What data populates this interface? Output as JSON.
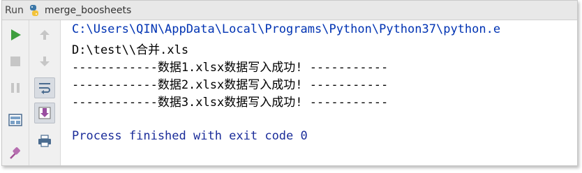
{
  "window": {
    "panel_label": "Run",
    "config_name": "merge_boosheets"
  },
  "console": {
    "lines": [
      "C:\\Users\\QIN\\AppData\\Local\\Programs\\Python\\Python37\\python.e",
      "D:\\test\\\\合并.xls",
      "------------数据1.xlsx数据写入成功! -----------",
      "------------数据2.xlsx数据写入成功! -----------",
      "------------数据3.xlsx数据写入成功! -----------",
      "",
      "Process finished with exit code 0"
    ]
  },
  "colors": {
    "command_text": "#0033b3",
    "finished_text": "#1b2d9a",
    "run_green": "#3e9e3e"
  },
  "icons": {
    "left_toolbar": [
      "run-icon",
      "stop-icon",
      "pause-icon",
      "layout-icon",
      "pin-icon"
    ],
    "second_toolbar": [
      "up-arrow-icon",
      "down-arrow-icon",
      "soft-wrap-icon",
      "scroll-to-end-icon",
      "print-icon"
    ]
  }
}
